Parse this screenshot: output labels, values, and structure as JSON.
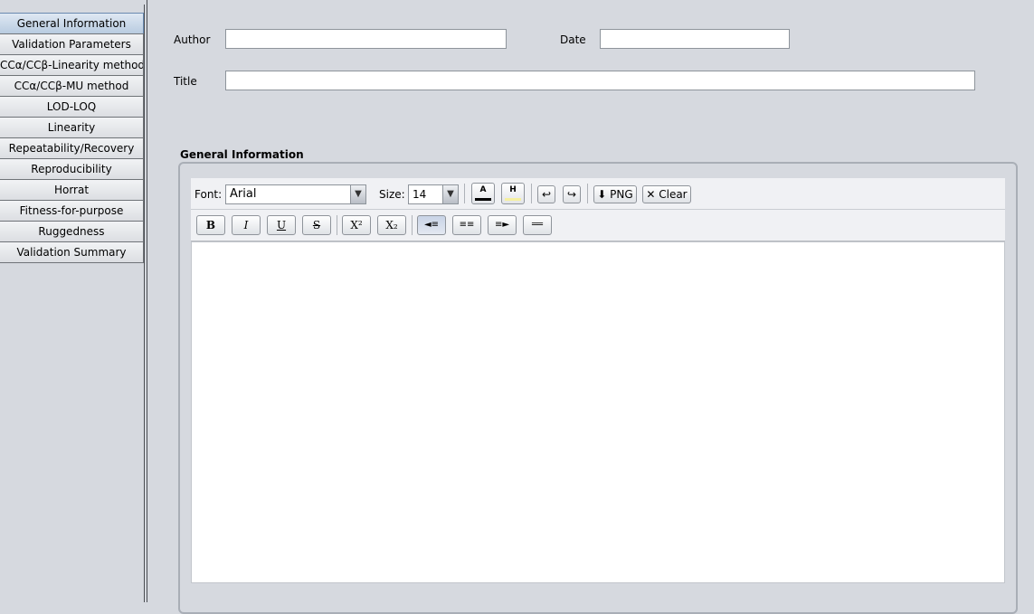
{
  "sidebar": {
    "items": [
      {
        "label": "General Information",
        "active": true
      },
      {
        "label": "Validation Parameters",
        "active": false
      },
      {
        "label": "CCα/CCβ-Linearity method",
        "active": false
      },
      {
        "label": "CCα/CCβ-MU method",
        "active": false
      },
      {
        "label": "LOD-LOQ",
        "active": false
      },
      {
        "label": "Linearity",
        "active": false
      },
      {
        "label": "Repeatability/Recovery",
        "active": false
      },
      {
        "label": "Reproducibility",
        "active": false
      },
      {
        "label": "Horrat",
        "active": false
      },
      {
        "label": "Fitness-for-purpose",
        "active": false
      },
      {
        "label": "Ruggedness",
        "active": false
      },
      {
        "label": "Validation Summary",
        "active": false
      }
    ]
  },
  "form": {
    "author_label": "Author",
    "author_value": "",
    "date_label": "Date",
    "date_value": "",
    "title_label": "Title",
    "title_value": ""
  },
  "editor": {
    "section_title": "General Information",
    "font_label": "Font:",
    "font_value": "Arial",
    "size_label": "Size:",
    "size_value": "14",
    "text_color_label": "A",
    "text_color": "#000000",
    "highlight_label": "H",
    "highlight_color": "#f5f0a0",
    "undo_icon": "↩",
    "redo_icon": "↪",
    "png_label": "⬇ PNG",
    "clear_label": "✕ Clear",
    "bold_label": "B",
    "italic_label": "I",
    "underline_label": "U",
    "strike_label": "S",
    "superscript_label": "X²",
    "subscript_label": "X₂",
    "align_left_label": "◄≡",
    "align_center_label": "≡≡",
    "align_right_label": "≡►",
    "justify_label": "══",
    "content": ""
  },
  "colors": {
    "background": "#d6d9df",
    "active_nav": "#b8cbe0",
    "editor_bg": "#ffffff"
  }
}
